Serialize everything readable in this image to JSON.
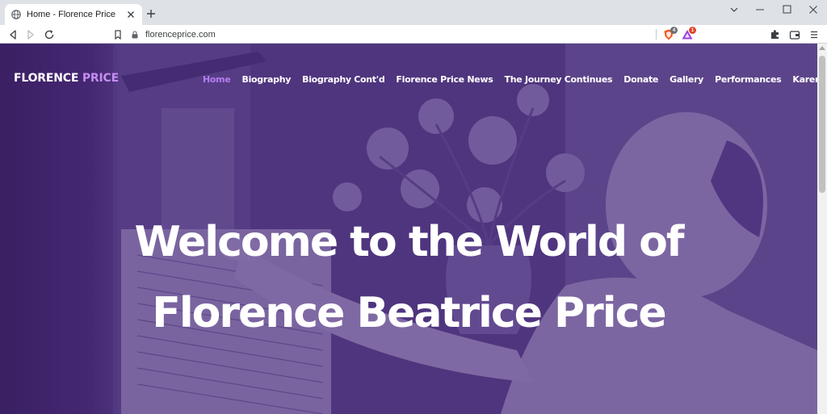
{
  "browser": {
    "tab": {
      "title": "Home - Florence Price",
      "favicon": "globe-icon",
      "close_icon": "close-icon"
    },
    "new_tab_icon": "plus-icon",
    "window_controls": [
      "chevron-down-icon",
      "minimize-icon",
      "maximize-icon",
      "close-icon"
    ],
    "toolbar": {
      "back_icon": "back-arrow-icon",
      "forward_icon": "forward-arrow-icon",
      "reload_icon": "reload-icon",
      "bookmark_icon": "bookmark-icon",
      "lock_icon": "lock-icon",
      "url": "florenceprice.com",
      "brave_shield_count": "4",
      "brave_rewards_count": "1",
      "extensions_icon": "puzzle-icon",
      "wallet_icon": "wallet-icon",
      "menu_icon": "hamburger-menu-icon"
    }
  },
  "site": {
    "logo": {
      "first": "FLORENCE",
      "second": "PRICE"
    },
    "nav": [
      {
        "label": "Home",
        "active": true
      },
      {
        "label": "Biography"
      },
      {
        "label": "Biography Cont'd"
      },
      {
        "label": "Florence Price News"
      },
      {
        "label": "The Journey Continues"
      },
      {
        "label": "Donate"
      },
      {
        "label": "Gallery"
      },
      {
        "label": "Performances"
      },
      {
        "label": "Karen Walwyn"
      }
    ],
    "hero": {
      "line1": "Welcome to the World of",
      "line2": "Florence Beatrice Price"
    }
  },
  "colors": {
    "brand_accent": "#b57df0",
    "hero_overlay": "#482a7d",
    "nav_text": "#ffffff"
  }
}
